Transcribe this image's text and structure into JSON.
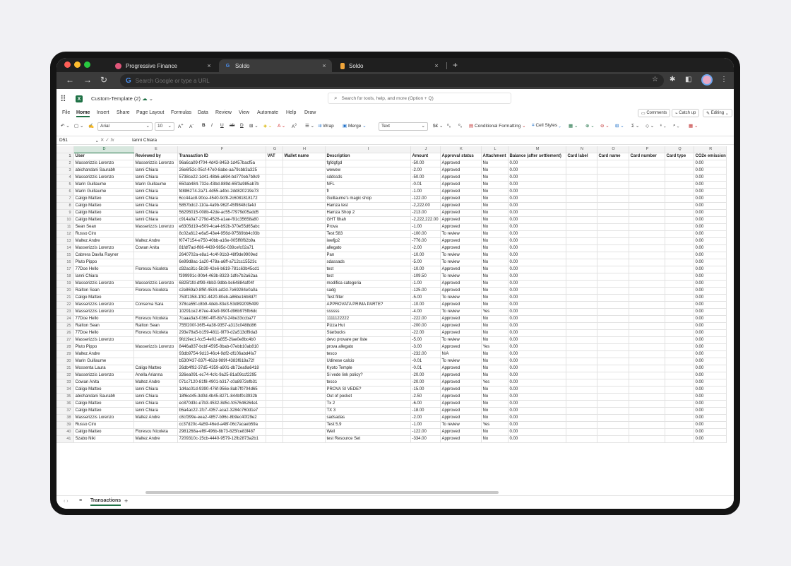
{
  "browser": {
    "tabs": [
      {
        "label": "Progressive Finance",
        "active": false,
        "icon_color": "#e0567a"
      },
      {
        "label": "Soldo",
        "active": true,
        "icon_color": "#4a90f0"
      },
      {
        "label": "Soldo",
        "active": false,
        "icon_color": "#f0a53a"
      }
    ],
    "close_glyph": "×",
    "new_tab": "+",
    "omnibox_placeholder": "Search Google or type a URL",
    "google_glyph": "G"
  },
  "sheets": {
    "doc_name": "Custom-Template (2)",
    "search_placeholder": "Search for tools, help, and more (Option + Q)",
    "ribbon_tabs": [
      "File",
      "Home",
      "Insert",
      "Share",
      "Page Layout",
      "Formulas",
      "Data",
      "Review",
      "View",
      "Automate",
      "Help",
      "Draw"
    ],
    "active_ribbon_tab": "Home",
    "comments_label": "Comments",
    "catchup_label": "Catch up",
    "editing_label": "Editing",
    "toolbar": {
      "font": "Arial",
      "font_size": "10",
      "wrap": "Wrap",
      "merge": "Merge",
      "number_format": "Text",
      "conditional": "Conditional Formatting",
      "cell_styles": "Cell Styles"
    },
    "name_box": "D51",
    "formula_value": "Ianni Chiara",
    "col_letters": [
      "D",
      "E",
      "F",
      "G",
      "H",
      "I",
      "J",
      "K",
      "L",
      "M",
      "N",
      "O",
      "P",
      "Q",
      "R"
    ],
    "headers": [
      "User",
      "Reviewed by",
      "Transaction ID",
      "VAT",
      "Wallet name",
      "Description",
      "Amount",
      "Approval status",
      "Attachment",
      "Balance (after settlement)",
      "Card label",
      "Card name",
      "Card number",
      "Card type",
      "CO2e emission"
    ],
    "rows": [
      [
        "Masserizzis Lorenzo",
        "Masserizzis Lorenzo",
        "96a6ca09-f704-4d43-8453-1d457bacf5a",
        "",
        "",
        "fgfdgfgd",
        "-50.00",
        "Approved",
        "No",
        "0.00",
        "",
        "",
        "",
        "",
        "0.00"
      ],
      [
        "abichandani Saurabh",
        "Ianni Chiara",
        "26e6f52c-05cf-47e0-8abe-aa79cbb3a325",
        "",
        "",
        "wewew",
        "-2.00",
        "Approved",
        "No",
        "0.00",
        "",
        "",
        "",
        "",
        "0.00"
      ],
      [
        "Masserizzis Lorenzo",
        "Ianni Chiara",
        "5738ce22-1d41-48b6-a694-bd770eb7b9c9",
        "",
        "",
        "sddssds",
        "-50.00",
        "Approved",
        "No",
        "0.00",
        "",
        "",
        "",
        "",
        "0.00"
      ],
      [
        "Marin Guillaume",
        "Marin Guillaume",
        "650ab484-732e-43bd-889d-65f3a985ab7b",
        "",
        "",
        "NFL",
        "-0.01",
        "Approved",
        "No",
        "0.00",
        "",
        "",
        "",
        "",
        "0.00"
      ],
      [
        "Marin Guillaume",
        "Ianni Chiara",
        "fd886274-2a71-4d55-a4bc-2dd820219e73",
        "",
        "",
        "fr",
        "-1.00",
        "Approved",
        "No",
        "0.00",
        "",
        "",
        "",
        "",
        "0.00"
      ],
      [
        "Caligo Matteo",
        "Ianni Chiara",
        "6cc44ac8-90ce-4540-9cf8-2c6081818172",
        "",
        "",
        "Guillaume's magic shop",
        "-122.00",
        "Approved",
        "No",
        "0.00",
        "",
        "",
        "",
        "",
        "0.00"
      ],
      [
        "Caligo Matteo",
        "Ianni Chiara",
        "5857bdc2-110a-4a9b-962f-45f9848cfa4d",
        "",
        "",
        "Hamza test",
        "-2,222.00",
        "Approved",
        "No",
        "0.00",
        "",
        "",
        "",
        "",
        "0.00"
      ],
      [
        "Caligo Matteo",
        "Ianni Chiara",
        "56295015-008b-42de-ac55-f7979d05add5",
        "",
        "",
        "Hamza Shop 2",
        "-213.00",
        "Approved",
        "No",
        "0.00",
        "",
        "",
        "",
        "",
        "0.00"
      ],
      [
        "Caligo Matteo",
        "Ianni Chiara",
        "c914a0a7-279d-4526-a1ae-f91c35658a80",
        "",
        "",
        "GHT fthah",
        "-2,222,222.00",
        "Approved",
        "No",
        "0.00",
        "",
        "",
        "",
        "",
        "0.00"
      ],
      [
        "Sean Sean",
        "Masserizzis Lorenzo",
        "e6305d19-e509-4ca4-b92b-370e55d65abc",
        "",
        "",
        "Prova",
        "-1.00",
        "Approved",
        "No",
        "0.00",
        "",
        "",
        "",
        "",
        "0.00"
      ],
      [
        "Russo Ciro",
        "",
        "8c02a612-e6a5-43e4-956d-97569bb4c03b",
        "",
        "",
        "Test 583",
        "-100.00",
        "To review",
        "No",
        "0.00",
        "",
        "",
        "",
        "",
        "0.00"
      ],
      [
        "Maltez Andre",
        "Maltez Andre",
        "f0747154-e750-40bb-a16e-005ff0f62b9a",
        "",
        "",
        "iwefjp2",
        "-776.00",
        "Approved",
        "No",
        "0.00",
        "",
        "",
        "",
        "",
        "0.00"
      ],
      [
        "Masserizzis Lorenzo",
        "Cowan Anita",
        "81fdf7ad-ff86-4439-985d-039cefc02a71",
        "",
        "",
        "allegato",
        "-2.00",
        "Approved",
        "No",
        "0.00",
        "",
        "",
        "",
        "",
        "0.00"
      ],
      [
        "Cabrera Davila Rayner",
        "",
        "2640702a-e8a1-4c4f-91b3-48f9de9909ed",
        "",
        "",
        "Pan",
        "-10.00",
        "To review",
        "No",
        "0.00",
        "",
        "",
        "",
        "",
        "0.00"
      ],
      [
        "Pluto Pippo",
        "",
        "6e99d8ac-1a20-478a-a6ff-a712cc15523c",
        "",
        "",
        "sdassads",
        "-5.00",
        "To review",
        "No",
        "0.00",
        "",
        "",
        "",
        "",
        "0.00"
      ],
      [
        "77Doe Hello",
        "Florescu Nicoleta",
        "d32ac81c-5b39-42e6-b619-781c63b45cd1",
        "",
        "",
        "test",
        "-10.00",
        "Approved",
        "No",
        "0.00",
        "",
        "",
        "",
        "",
        "0.00"
      ],
      [
        "Ianni Chiara",
        "",
        "f399991c-90b4-463b-8323-1dfe7b2a62aa",
        "",
        "",
        "test",
        "-109.50",
        "To review",
        "No",
        "0.00",
        "",
        "",
        "",
        "",
        "0.00"
      ],
      [
        "Masserizzis Lorenzo",
        "Masserizzis Lorenzo",
        "6825f1fd-df99-4bb3-9dbb-bc64884af04f",
        "",
        "",
        "modifica categoria",
        "-1.00",
        "Approved",
        "No",
        "0.00",
        "",
        "",
        "",
        "",
        "0.00"
      ],
      [
        "Railton Sean",
        "Florescu Nicoleta",
        "c2e869a0-8f6f-4534-ad2d-7e69284e0a0a",
        "",
        "",
        "sadg",
        "-125.00",
        "Approved",
        "No",
        "0.00",
        "",
        "",
        "",
        "",
        "0.00"
      ],
      [
        "Caligo Matteo",
        "",
        "753f1358-1f82-4420-80eb-a86be16b8d7f",
        "",
        "",
        "Test filter",
        "-5.00",
        "To review",
        "No",
        "0.00",
        "",
        "",
        "",
        "",
        "0.00"
      ],
      [
        "Masserizzis Lorenzo",
        "Conserva Sara",
        "378ca55f-c8b9-4deb-83e3-53d892095499",
        "",
        "",
        "APPROVATA PRIMA PARTE?",
        "-10.00",
        "Approved",
        "No",
        "0.00",
        "",
        "",
        "",
        "",
        "0.00"
      ],
      [
        "Masserizzis Lorenzo",
        "",
        "10291ce2-67ee-40e9-990f-d96b975fb6dc",
        "",
        "",
        "ssssss",
        "-4.00",
        "To review",
        "Yes",
        "0.00",
        "",
        "",
        "",
        "",
        "0.00"
      ],
      [
        "77Doe Hello",
        "Florescu Nicoleta",
        "7caaa3a3-0360-4fff-8b7d-24be33ccba77",
        "",
        "",
        "1111122222",
        "-222.00",
        "Approved",
        "No",
        "0.00",
        "",
        "",
        "",
        "",
        "0.00"
      ],
      [
        "Railton Sean",
        "Railton Sean",
        "755f200f-36f5-4a38-9357-a313c0488d86",
        "",
        "",
        "Pizza Hut",
        "-200.00",
        "Approved",
        "No",
        "0.00",
        "",
        "",
        "",
        "",
        "0.00"
      ],
      [
        "77Doe Hello",
        "Florescu Nicoleta",
        "293e78a5-b159-4811-9f70-d2a513df9da3",
        "",
        "",
        "Starbucks",
        "-22.00",
        "Approved",
        "No",
        "0.00",
        "",
        "",
        "",
        "",
        "0.00"
      ],
      [
        "Masserizzis Lorenzo",
        "",
        "9fd19ec1-fcc5-4e02-a855-2fae0e8bc4b0",
        "",
        "",
        "devo provare per liste",
        "-5.00",
        "To review",
        "No",
        "0.00",
        "",
        "",
        "",
        "",
        "0.00"
      ],
      [
        "Pluto Pippo",
        "Masserizzis Lorenzo",
        "8446a837-bcbf-4595-8bab-07ebb10ab810",
        "",
        "",
        "prova allegato",
        "-3.00",
        "Approved",
        "Yes",
        "0.00",
        "",
        "",
        "",
        "",
        "0.00"
      ],
      [
        "Maltez Andre",
        "",
        "93db9754-9d13-46c4-9df2-df106abd4fa7",
        "",
        "",
        "tesco",
        "-232.00",
        "N/A",
        "No",
        "0.00",
        "",
        "",
        "",
        "",
        "0.00"
      ],
      [
        "Marin Guillaume",
        "",
        "b530f437-837f-462d-989f-4383f618a72f",
        "",
        "",
        "Udinese calcio",
        "-0.01",
        "To review",
        "No",
        "0.00",
        "",
        "",
        "",
        "",
        "0.00"
      ],
      [
        "Mossenta Laura",
        "Caligo Matteo",
        "26db4f92-37d5-4359-a901-db72ea9a6418",
        "",
        "",
        "Kyoto Temple",
        "-0.01",
        "Approved",
        "No",
        "0.00",
        "",
        "",
        "",
        "",
        "0.00"
      ],
      [
        "Masserizzis Lorenzo",
        "Anella Arianna",
        "326ea091-ec74-4cfc-9a25-81a09ccf2295",
        "",
        "",
        "Si vede link policy?",
        "-20.00",
        "Approved",
        "No",
        "0.00",
        "",
        "",
        "",
        "",
        "0.00"
      ],
      [
        "Cowan Anita",
        "Maltez Andre",
        "071c7120-81f8-4901-b317-c0a8972efb31",
        "",
        "",
        "tesco",
        "-20.00",
        "Approved",
        "Yes",
        "0.00",
        "",
        "",
        "",
        "",
        "0.00"
      ],
      [
        "Caligo Matteo",
        "Ianni Chiara",
        "1d4ac01d-9390-476f-956e-8ab7f0704d65",
        "",
        "",
        "PROVA SI VEDE?",
        "-15.00",
        "Approved",
        "No",
        "0.00",
        "",
        "",
        "",
        "",
        "0.00"
      ],
      [
        "abichandani Saurabh",
        "Ianni Chiara",
        "18f6cd45-3d0d-4b45-8271-844bf0c3932b",
        "",
        "",
        "Out of pocket",
        "-2.50",
        "Approved",
        "No",
        "0.00",
        "",
        "",
        "",
        "",
        "0.00"
      ],
      [
        "Caligo Matteo",
        "Ianni Chiara",
        "ec870d3c-e7b3-4532-8d5c-fc57646264e1",
        "",
        "",
        "Tx 2",
        "-6.00",
        "Approved",
        "No",
        "0.00",
        "",
        "",
        "",
        "",
        "0.00"
      ],
      [
        "Caligo Matteo",
        "Ianni Chiara",
        "b5a4ac22-1fc7-4357-aca2-3284c760d1e7",
        "",
        "",
        "TX 3",
        "-18.00",
        "Approved",
        "No",
        "0.00",
        "",
        "",
        "",
        "",
        "0.00"
      ],
      [
        "Masserizzis Lorenzo",
        "Maltez Andre",
        "c8cf399e-eea2-4857-b96c-8b9ec40f29e2",
        "",
        "",
        "sadsadas",
        "-2.00",
        "Approved",
        "No",
        "0.00",
        "",
        "",
        "",
        "",
        "0.00"
      ],
      [
        "Russo Ciro",
        "",
        "cc37d20c-4a59-46ed-a48f-06c7acaeb59a",
        "",
        "",
        "Test 5.9",
        "-1.00",
        "To review",
        "Yes",
        "0.00",
        "",
        "",
        "",
        "",
        "0.00"
      ],
      [
        "Caligo Matteo",
        "Florescu Nicoleta",
        "2981268a-ef6f-496b-8b73-825fce83f487",
        "",
        "",
        "Weil",
        "-122.00",
        "Approved",
        "No",
        "0.00",
        "",
        "",
        "",
        "",
        "0.00"
      ],
      [
        "Szabo Niki",
        "Maltez Andre",
        "7209310c-15cb-4440-9579-12fb2873a2b1",
        "",
        "",
        "test Resource Set",
        "-334.00",
        "Approved",
        "No",
        "0.00",
        "",
        "",
        "",
        "",
        "0.00"
      ]
    ],
    "sheet_tab": "Transactions",
    "add_sheet": "+",
    "accent": "#1e7145"
  }
}
